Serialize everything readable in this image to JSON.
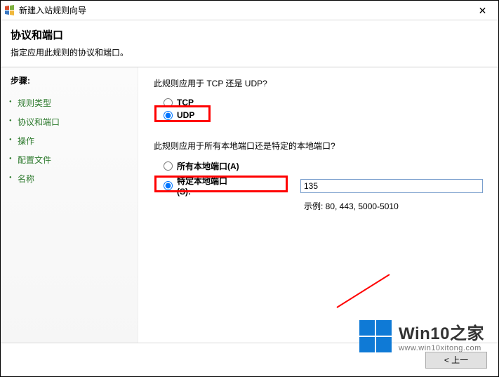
{
  "window": {
    "title": "新建入站规则向导",
    "close_glyph": "✕"
  },
  "header": {
    "title": "协议和端口",
    "desc": "指定应用此规则的协议和端口。"
  },
  "sidebar": {
    "heading": "步骤:",
    "items": [
      {
        "label": "规则类型"
      },
      {
        "label": "协议和端口"
      },
      {
        "label": "操作"
      },
      {
        "label": "配置文件"
      },
      {
        "label": "名称"
      }
    ]
  },
  "content": {
    "q1": "此规则应用于 TCP 还是 UDP?",
    "proto": {
      "tcp_label": "TCP",
      "udp_label": "UDP",
      "selected": "udp"
    },
    "q2": "此规则应用于所有本地端口还是特定的本地端口?",
    "ports": {
      "all_label": "所有本地端口(A)",
      "specific_label": "特定本地端口(S):",
      "selected": "specific",
      "value": "135",
      "example": "示例: 80, 443, 5000-5010"
    }
  },
  "footer": {
    "back": "< 上一"
  },
  "watermark": {
    "brand": "Win10之家",
    "url": "www.win10xitong.com"
  }
}
